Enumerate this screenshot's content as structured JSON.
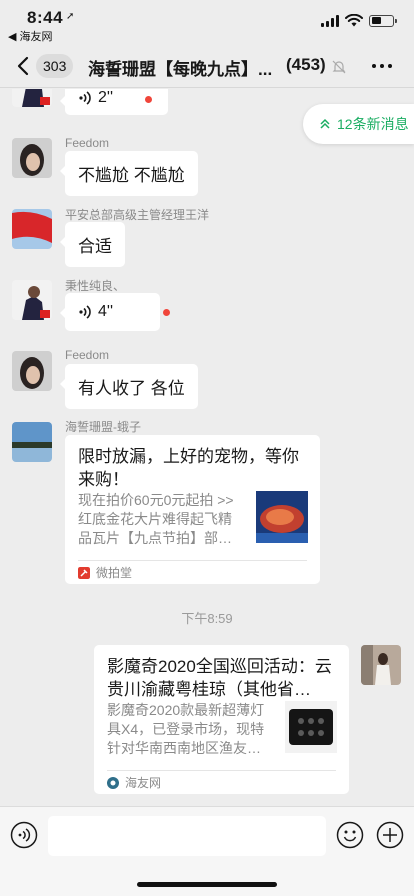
{
  "status_bar": {
    "time": "8:44",
    "back_app_label": "◀ 海友网"
  },
  "header": {
    "unread_count": "303",
    "title": "海誓珊盟【每晚九点】...",
    "member_count": "(453)"
  },
  "new_messages_pill": {
    "label": "12条新消息"
  },
  "messages": [
    {
      "type": "voice",
      "duration": "2''",
      "unread": true
    },
    {
      "sender": "Feedom",
      "text": "不尴尬 不尴尬"
    },
    {
      "sender": "平安总部高级主管经理王洋",
      "text": "合适"
    },
    {
      "sender": "秉性纯良、",
      "type": "voice",
      "duration": "4''",
      "unread": true
    },
    {
      "sender": "Feedom",
      "text": "有人收了 各位"
    },
    {
      "sender": "海誓珊盟-蛾子",
      "type": "link_card",
      "title": "限时放漏，上好的宠物，等你来购！",
      "description": "现在拍价60元0元起拍 >>红底金花大片难得起飞精品瓦片【九点节拍】部…",
      "source": "微拍堂"
    }
  ],
  "time_divider": "下午8:59",
  "outgoing_card": {
    "title": "影魔奇2020全国巡回活动：云贵川渝藏粤桂琼（其他省…",
    "description": "影魔奇2020款最新超薄灯具X4，已登录市场，现特针对华南西南地区渔友…",
    "source": "海友网"
  },
  "input_bar": {
    "placeholder": ""
  },
  "colors": {
    "accent": "#1aad62",
    "unread_dot": "#f0453a",
    "background": "#ededed"
  }
}
